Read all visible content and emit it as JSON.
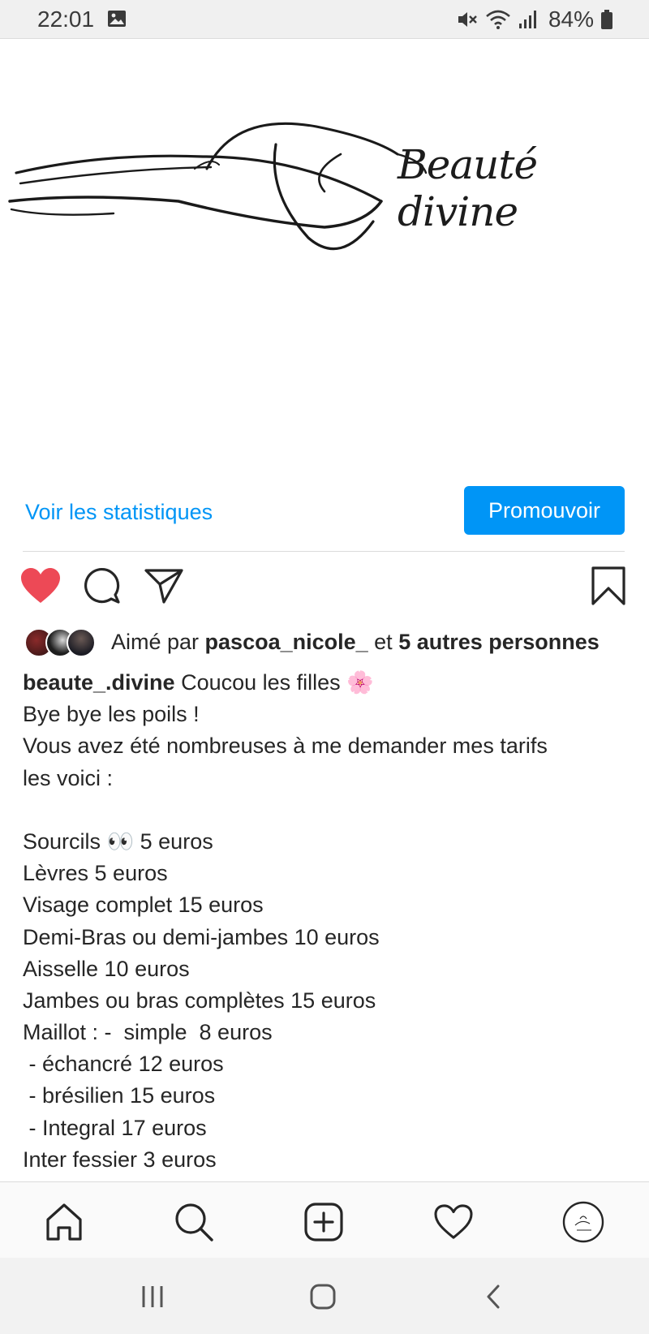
{
  "status_bar": {
    "time": "22:01",
    "battery": "84%",
    "icons": [
      "image-icon",
      "mute-icon",
      "wifi-icon",
      "signal-icon",
      "battery-icon"
    ]
  },
  "post": {
    "brand_text": "Beauté divine",
    "insights": {
      "stats_link": "Voir les statistiques",
      "promote_label": "Promouvoir"
    },
    "actions": [
      "heart-icon",
      "comment-icon",
      "share-icon",
      "bookmark-icon"
    ],
    "liked": true,
    "likes": {
      "prefix": "Aimé par ",
      "user": "pascoa_nicole_",
      "middle": " et ",
      "others": "5 autres personnes"
    },
    "caption": {
      "username": "beaute_.divine",
      "first_line": " Coucou les filles 🌸",
      "lines": [
        "Bye bye les poils !",
        "Vous avez été nombreuses à me demander mes tarifs",
        "les voici :",
        "",
        "Sourcils 👀 5 euros",
        "Lèvres 5 euros",
        "Visage complet 15 euros",
        "Demi-Bras ou demi-jambes 10 euros",
        "Aisselle 10 euros",
        "Jambes ou bras complètes 15 euros",
        "Maillot : -  simple  8 euros",
        " - échancré 12 euros",
        " - brésilien 15 euros",
        " - Integral 17 euros",
        "Inter fessier 3 euros"
      ]
    }
  },
  "bottom_nav": [
    "home-icon",
    "search-icon",
    "create-icon",
    "activity-icon",
    "profile-avatar"
  ],
  "system_nav": [
    "recent-apps-icon",
    "home-button-icon",
    "back-icon"
  ],
  "colors": {
    "accent": "#0095f6",
    "like_red": "#ed4956",
    "text": "#262626"
  }
}
